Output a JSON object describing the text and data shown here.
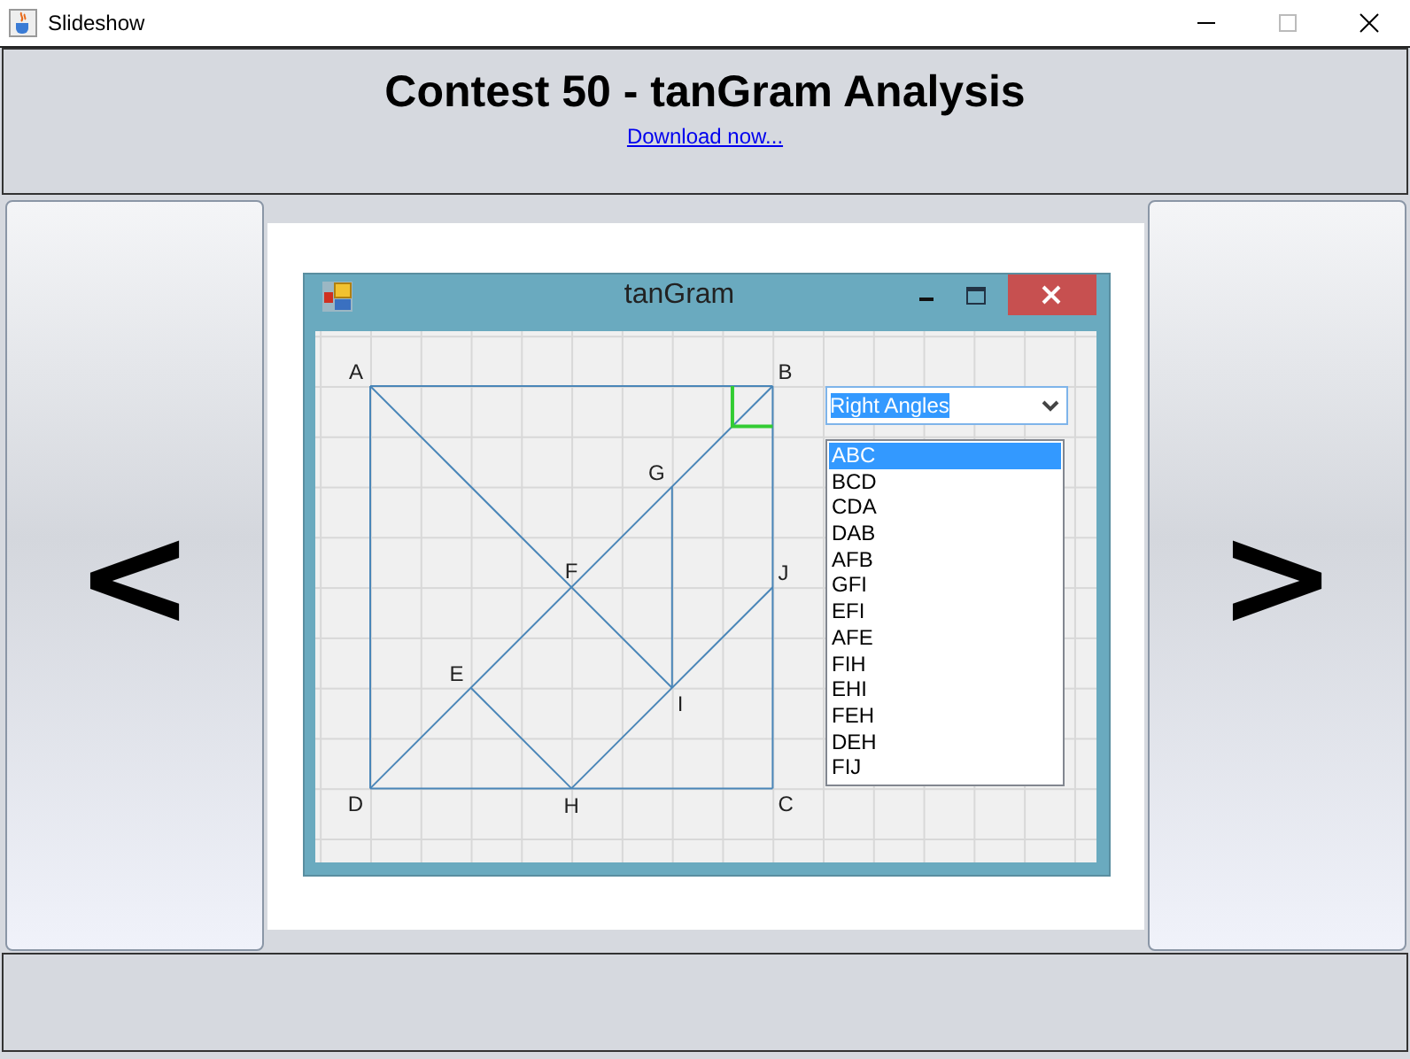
{
  "window": {
    "title": "Slideshow"
  },
  "header": {
    "title": "Contest 50 - tanGram Analysis",
    "link": "Download now..."
  },
  "nav": {
    "prev": "<",
    "next": ">"
  },
  "slide": {
    "window": {
      "title": "tanGram"
    },
    "points": [
      "A",
      "B",
      "G",
      "F",
      "J",
      "E",
      "I",
      "D",
      "H",
      "C"
    ],
    "dropdown": {
      "value": "Right Angles"
    },
    "angles": [
      {
        "label": "ABC",
        "selected": true
      },
      {
        "label": "BCD",
        "selected": false
      },
      {
        "label": "CDA",
        "selected": false
      },
      {
        "label": "DAB",
        "selected": false
      },
      {
        "label": "AFB",
        "selected": false
      },
      {
        "label": "GFI",
        "selected": false
      },
      {
        "label": "EFI",
        "selected": false
      },
      {
        "label": "AFE",
        "selected": false
      },
      {
        "label": "FIH",
        "selected": false
      },
      {
        "label": "EHI",
        "selected": false
      },
      {
        "label": "FEH",
        "selected": false
      },
      {
        "label": "DEH",
        "selected": false
      },
      {
        "label": "FIJ",
        "selected": false
      }
    ]
  }
}
